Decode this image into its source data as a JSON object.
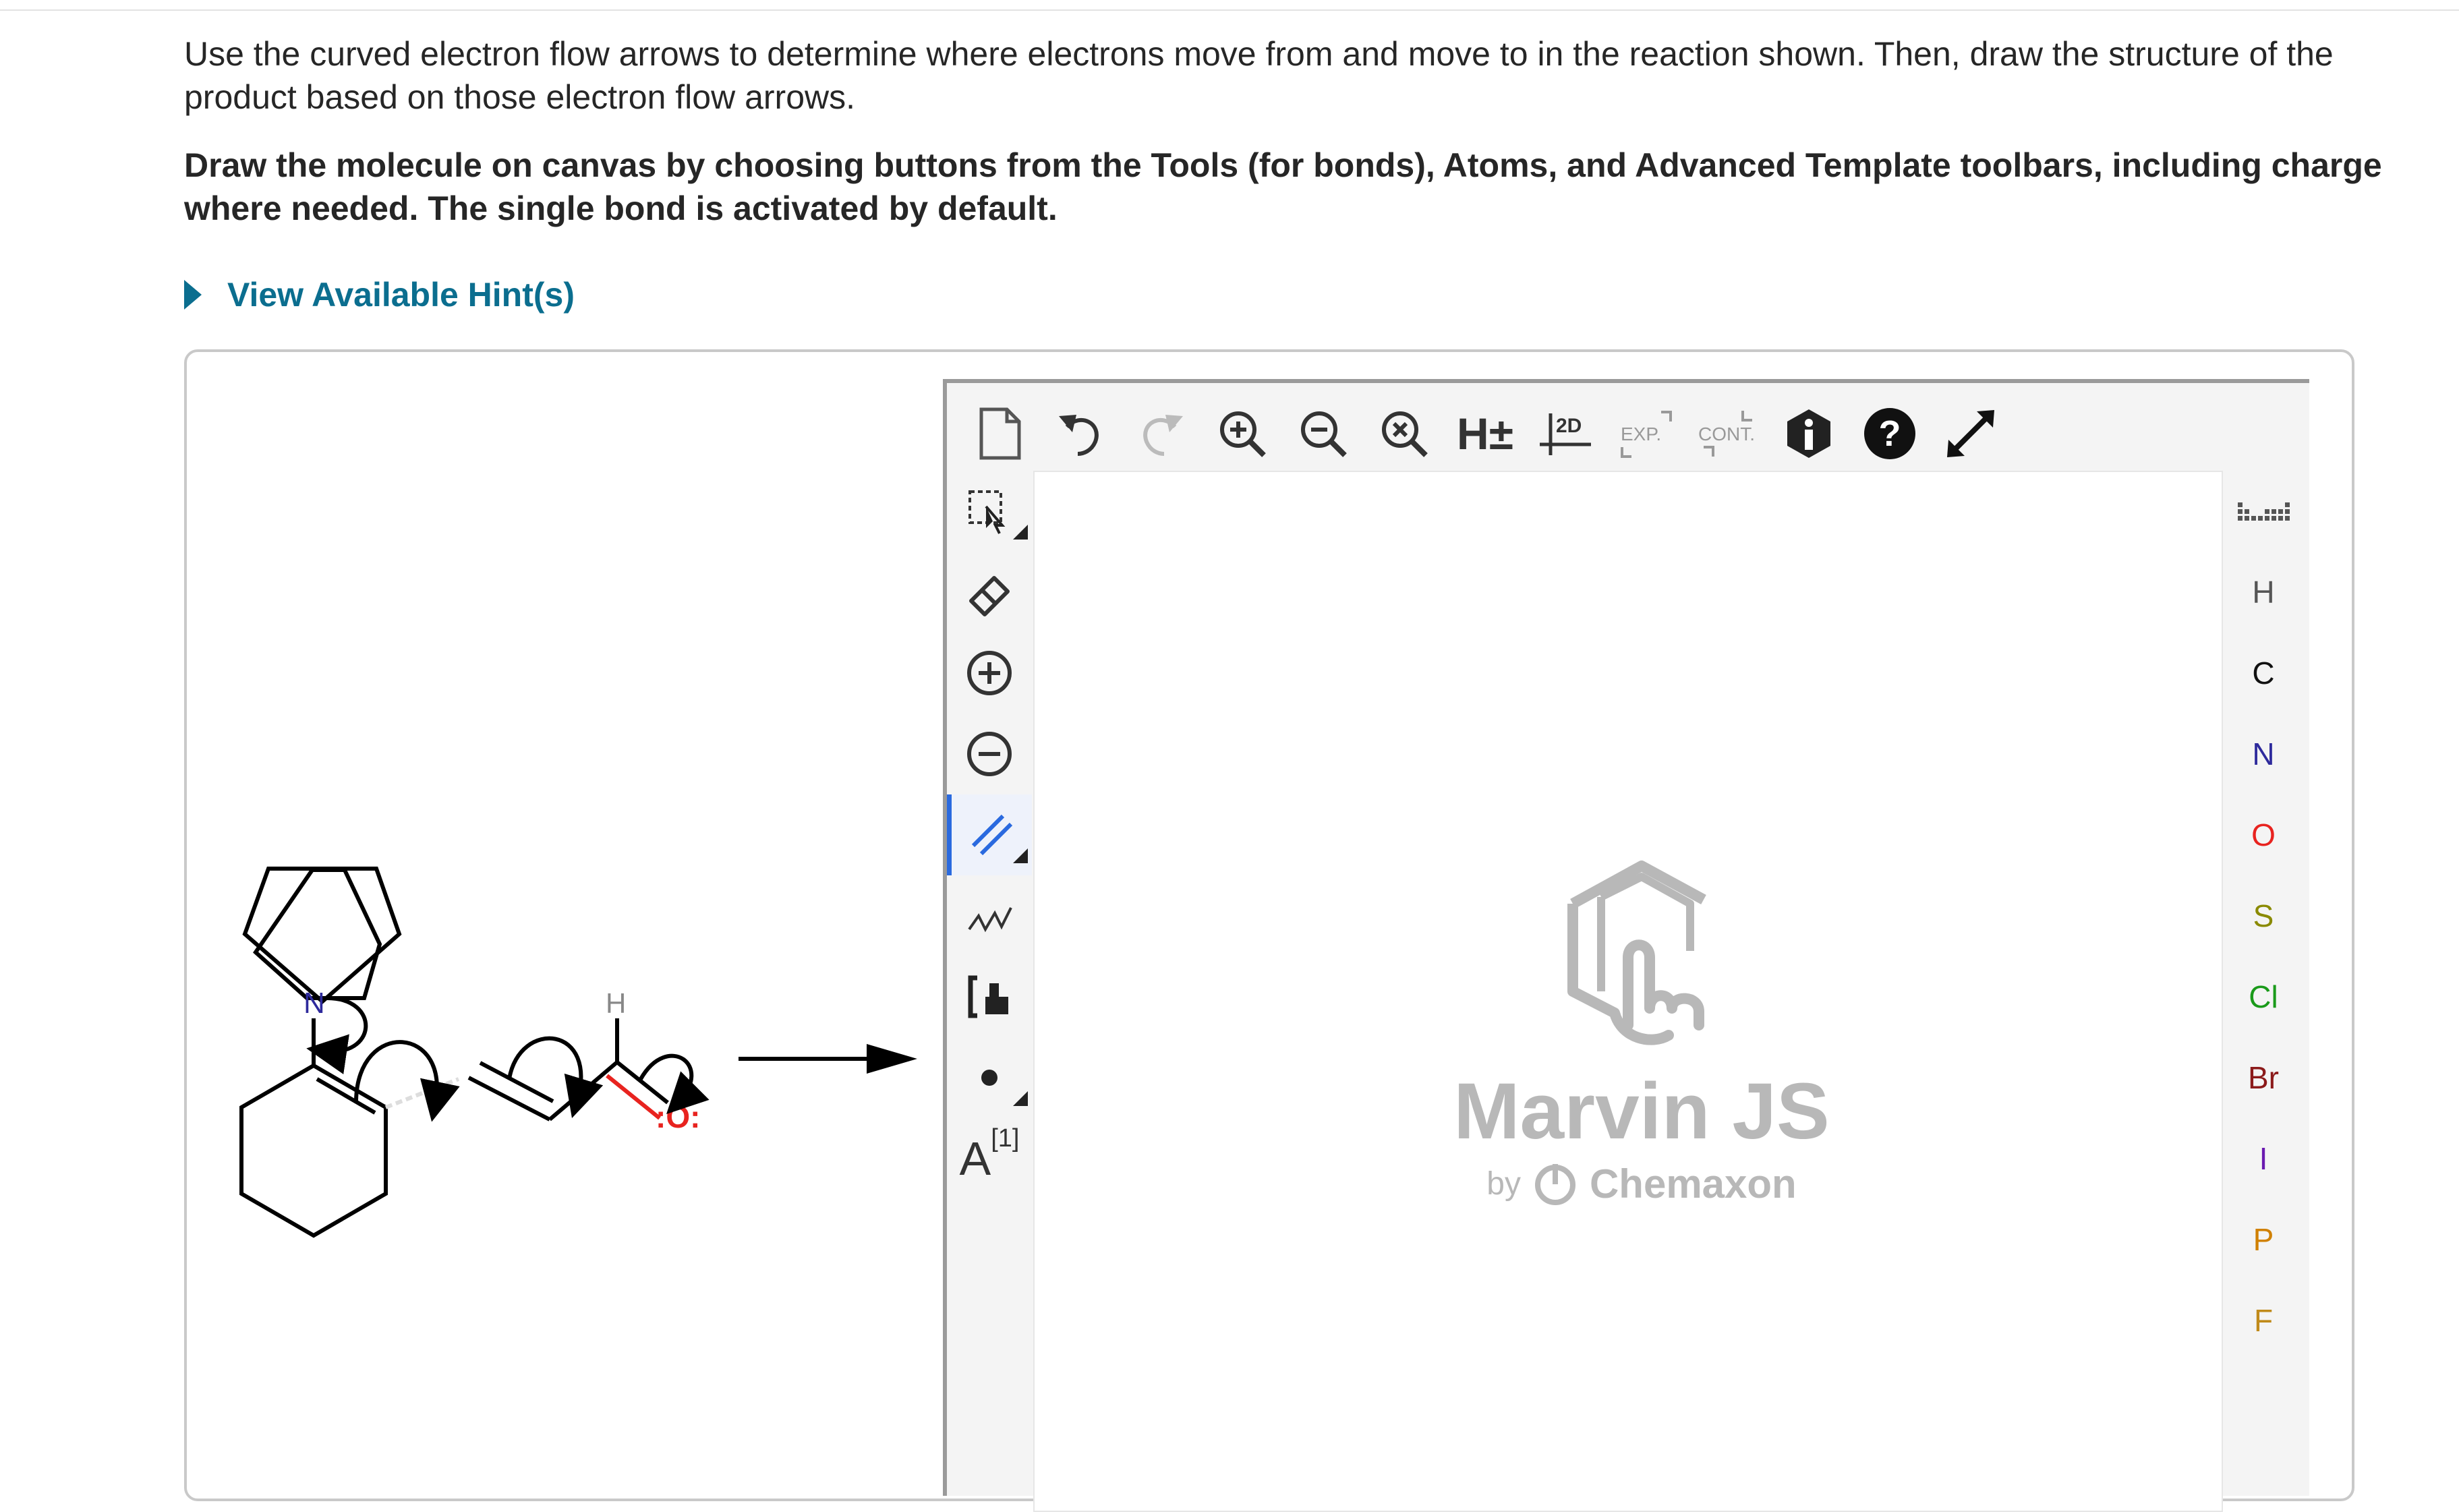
{
  "question": {
    "line1": "Use the curved electron flow arrows to determine where electrons move from and move to in the reaction shown. Then, draw the structure of the product based on those electron flow arrows.",
    "line2": "Draw the molecule on canvas by choosing buttons from the Tools (for bonds), Atoms, and Advanced Template toolbars, including charge where needed.  The single bond is activated by default."
  },
  "hint": {
    "label": "View Available Hint(s)"
  },
  "reaction": {
    "nitrogen_label": "N",
    "hydrogen_label": "H",
    "oxygen_label": ":O:"
  },
  "editor": {
    "top_toolbar": [
      {
        "icon": "new-document-icon"
      },
      {
        "icon": "undo-icon"
      },
      {
        "icon": "redo-icon"
      },
      {
        "icon": "zoom-in-icon"
      },
      {
        "icon": "zoom-out-icon"
      },
      {
        "icon": "zoom-reset-icon"
      },
      {
        "icon": "hydrogen-toggle-icon",
        "label": "H±"
      },
      {
        "icon": "clean-2d-icon",
        "label": "2D"
      },
      {
        "icon": "expand-group-icon",
        "label": "EXP."
      },
      {
        "icon": "contract-group-icon",
        "label": "CONT."
      },
      {
        "icon": "info-icon"
      },
      {
        "icon": "help-icon"
      },
      {
        "icon": "fullscreen-icon"
      }
    ],
    "left_toolbar": [
      {
        "icon": "selection-icon"
      },
      {
        "icon": "eraser-icon"
      },
      {
        "icon": "plus-charge-icon"
      },
      {
        "icon": "minus-charge-icon"
      },
      {
        "icon": "double-bond-icon",
        "active": true
      },
      {
        "icon": "chain-icon"
      },
      {
        "icon": "bracket-icon"
      },
      {
        "icon": "radical-icon"
      },
      {
        "icon": "atom-map-icon",
        "label": "A",
        "superscript": "[1]"
      }
    ],
    "right_toolbar": {
      "periodic_icon": "periodic-table-icon",
      "atoms": [
        {
          "symbol": "H",
          "color": "#555555"
        },
        {
          "symbol": "C",
          "color": "#111111"
        },
        {
          "symbol": "N",
          "color": "#2e2a9c"
        },
        {
          "symbol": "O",
          "color": "#e8231f"
        },
        {
          "symbol": "S",
          "color": "#8a8a00"
        },
        {
          "symbol": "Cl",
          "color": "#1a9a1a"
        },
        {
          "symbol": "Br",
          "color": "#8b1a1a"
        },
        {
          "symbol": "I",
          "color": "#6a1ab0"
        },
        {
          "symbol": "P",
          "color": "#d08000"
        },
        {
          "symbol": "F",
          "color": "#c08a1a"
        }
      ]
    },
    "watermark": {
      "title": "Marvin JS",
      "by": "by",
      "company": "Chemaxon"
    }
  }
}
